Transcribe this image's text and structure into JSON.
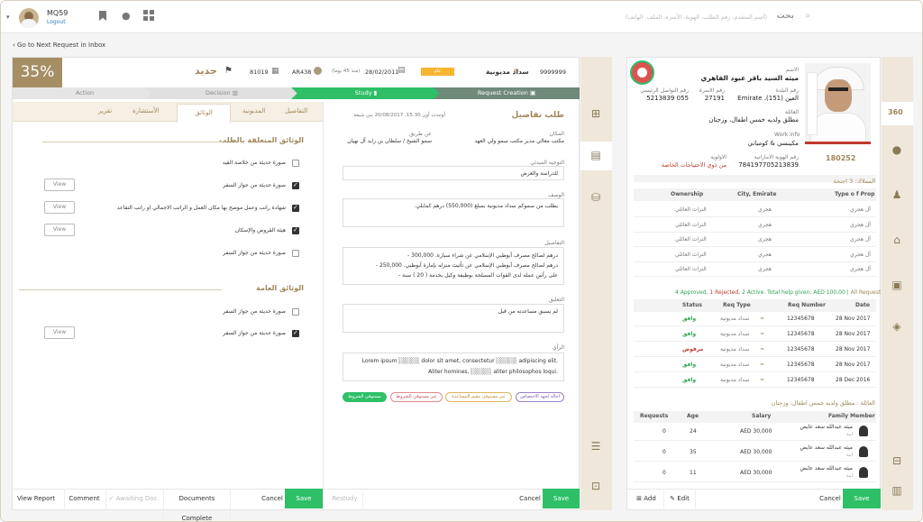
{
  "user": {
    "code": "MQ59",
    "logout": "Logout"
  },
  "search": {
    "label": "بحث",
    "placeholder": "(أسم المتقدم، رقم الطلب، الهوية، الأسرة، الملف، الهاتف)"
  },
  "nav": {
    "back": "Go to Next Request in Inbox"
  },
  "request": {
    "progress": "35%",
    "progress_value": 0.35,
    "status": "جديد",
    "number": "81019",
    "ar": "AR438",
    "date": "28/02/2011",
    "since": "(منذ 45 يوما)",
    "badge": "عام",
    "applicant": "سداد مديونية",
    "id": "9999999"
  },
  "stages": {
    "action": "Action",
    "decision": "Decision",
    "study": "Study",
    "creation": "Request Creation"
  },
  "tabs": {
    "details": "التفاصيل",
    "debt": "المديونية",
    "documents": "الوثائق",
    "consultation": "الأستشارة",
    "report": "تقرير"
  },
  "docs": {
    "section1": "الوثائق المتعلقة بالطلب",
    "section2": "الوثائق العامة",
    "items1": [
      {
        "label": "صورة حديثة من خلاصة القيد",
        "checked": false,
        "view": false
      },
      {
        "label": "صورة حديثة من جواز السفر",
        "checked": true,
        "view": true
      },
      {
        "label": "شهادة راتب وعمل موضح بها مكان العمل و الراتب الاجمالي او راتب التقاعد",
        "checked": true,
        "view": true
      },
      {
        "label": "هيئة القروض والإسكان",
        "checked": true,
        "view": true
      },
      {
        "label": "صورة حديثة من جواز السفر",
        "checked": false,
        "view": false
      }
    ],
    "items2": [
      {
        "label": "صورة حديثة من جواز السفر",
        "checked": false,
        "view": false
      },
      {
        "label": "صورة حديثة من جواز السفر",
        "checked": true,
        "view": true
      }
    ],
    "view_label": "View"
  },
  "leftfoot": {
    "view_report": "View Report",
    "comment": "Comment",
    "awaiting": "Awaiting Doc",
    "complete": "Documents Complete",
    "cancel": "Cancel",
    "save": "Save"
  },
  "details": {
    "title": "طلب تفاصيل",
    "created": "أوجدت أون 15:30, 20/08/2017 بني شبعة",
    "place_label": "المكان",
    "place": "مكتب معالي مدير مكتب سمو ولي العهد",
    "via_label": "عن طريق",
    "via": "سمو الشيخ / سلطان بن زايد آل نهيان",
    "direction_label": "التوجيه المبدئي",
    "direction": "للدراسة والعرض",
    "desc_label": "الوصف",
    "desc": "يطلب من سموكم سداد مديونية  بمبلغ (550,000)  درهم  كمابلي.",
    "detail_label": "التفاصيل",
    "detail_lines": [
      "درهم لصالح مصرف أبوظبي الإسلامي عن شراء سيارة. 300,000 -",
      "درهم لصالح مصرف أبوظبي الإسلامي عن تأثيث منزله بإمارة أبوظبي. 250,000 -",
      "على رأس عمله لدى القوات المسلحة بوظيفة وكيل بخدمة ( 20 ) سنة -"
    ],
    "comment_label": "التعليق",
    "comment": "لم يسبق مساعدته من قبل",
    "opinion_label": "الرأي",
    "opinion_lines": [
      "Lorem ipsum ░░░░░ dolor sit amet, consectetur ░░░░░ adipiscing elit.",
      "Aliter homines, ░░░░░ aliter philosophos loqui."
    ],
    "pills": [
      "احالة لجهة الاختصاص",
      "غير مستوفي الشروط",
      "غير مستوفي مقيم المساعدة",
      "مستوفي الشروط"
    ],
    "restudy": "Restudy",
    "cancel": "Cancel",
    "save": "Save"
  },
  "profile": {
    "name_label": "الاسم",
    "name": "ميثه السيد باقر عبود القاهري",
    "phone_label": "رقم التواصل الرئيسي",
    "phone": "055 5213839",
    "family_no_label": "رقم الاسرة",
    "family_no": "27191",
    "area_label": "رقم البلدة",
    "area": "العين (151)، Emirate",
    "family_label": "العائلة",
    "family": "مطلق ولديه خمس اطفال، وزجتان",
    "work_label": "Work info",
    "work": "مكينسي & كومباني",
    "priority_label": "الاولوية",
    "priority": "من ذوي الاحتياجات الخاصة",
    "eid_label": "رقم الهوية الاماراتية",
    "eid": "784197705213839",
    "badge": "180252",
    "badge360": "360"
  },
  "props": {
    "title": "المملاك: 3 اجنحة",
    "headers": [
      "Ownership",
      "City, Emirate",
      "Type o f Prop"
    ],
    "rows": [
      [
        "التراث العائلي",
        "هجري",
        "أل هجري"
      ],
      [
        "التراث العائلي",
        "هجري",
        "أل هجري"
      ],
      [
        "التراث العائلي",
        "هجري",
        "أل هجري"
      ],
      [
        "التراث العائلي",
        "هجري",
        "أل هجري"
      ],
      [
        "التراث العائلي",
        "هجري",
        "أل هجري"
      ]
    ]
  },
  "requests": {
    "summary_green": "4 Approved,",
    "summary_red": "1 Rejected,",
    "summary_rest": "2 Active. Total help given: AED 100,00 |",
    "summary_all": "All Request",
    "headers": [
      "Status",
      "Req Type",
      "Req Number",
      "Date"
    ],
    "rows": [
      [
        "وافق",
        "سداد مديونية",
        "12345678",
        "28 Nov 2017"
      ],
      [
        "وافق",
        "سداد مديونية",
        "12345678",
        "28 Nov 2017"
      ],
      [
        "مرفوض",
        "سداد مديونية",
        "12345678",
        "28 Nov 2017"
      ],
      [
        "وافق",
        "سداد مديونية",
        "12345678",
        "28 Nov 2017"
      ],
      [
        "وافق",
        "سداد مديونية",
        "12345678",
        "28 Dec 2016"
      ]
    ]
  },
  "fam": {
    "title": "العائلة : مطلق ولديه خمس اطفال، وزجتان",
    "headers": [
      "Requests",
      "Age",
      "Salary",
      "Family Member"
    ],
    "rows": [
      [
        "0",
        "24",
        "AED 30,000",
        "ميثه عبدالله سعد عايض",
        "ابنة"
      ],
      [
        "0",
        "35",
        "AED 30,000",
        "ميثه عبدالله سعد عايض",
        "ابنة"
      ],
      [
        "0",
        "11",
        "AED 30,000",
        "ميثه عبدالله سعد عايض",
        "ابنة"
      ]
    ],
    "add": "Add",
    "edit": "Edit",
    "cancel": "Cancel",
    "save": "Save"
  }
}
